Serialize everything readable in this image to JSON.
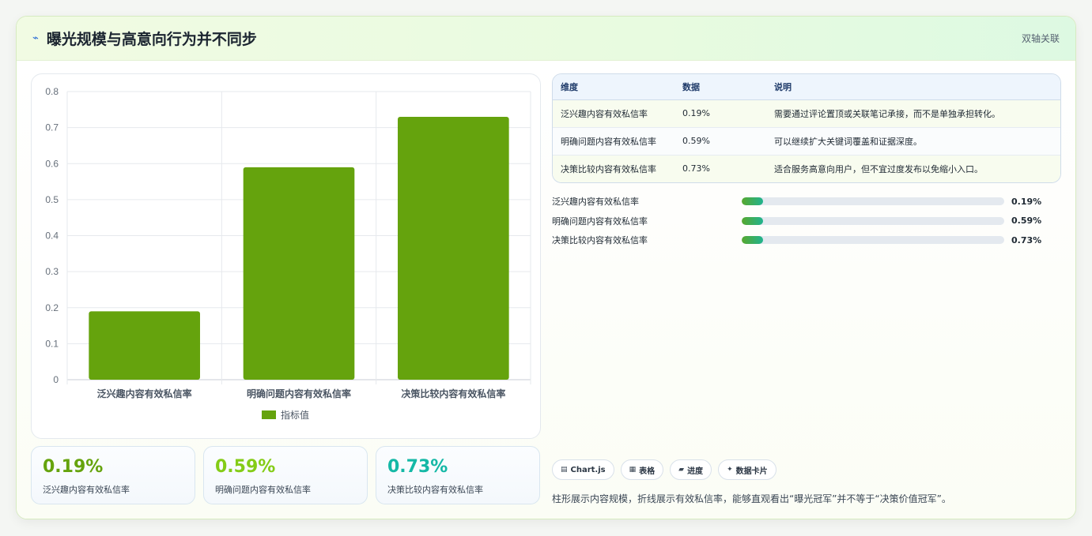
{
  "header": {
    "title": "曝光规模与高意向行为并不同步",
    "tag": "双轴关联"
  },
  "chart_data": {
    "type": "bar",
    "categories": [
      "泛兴趣内容有效私信率",
      "明确问题内容有效私信率",
      "决策比较内容有效私信率"
    ],
    "series": [
      {
        "name": "指标值",
        "values": [
          0.19,
          0.59,
          0.73
        ]
      }
    ],
    "yticks": [
      "0",
      "0.1",
      "0.2",
      "0.3",
      "0.4",
      "0.5",
      "0.6",
      "0.7",
      "0.8"
    ],
    "ylim": [
      0,
      0.8
    ],
    "grid": true,
    "legend": "bottom",
    "bar_color": "#65a30d"
  },
  "stats": [
    {
      "value": "0.19%",
      "label": "泛兴趣内容有效私信率",
      "color": "#65a30d"
    },
    {
      "value": "0.59%",
      "label": "明确问题内容有效私信率",
      "color": "#84cc16"
    },
    {
      "value": "0.73%",
      "label": "决策比较内容有效私信率",
      "color": "#14b8a6"
    }
  ],
  "table": {
    "headers": [
      "维度",
      "数据",
      "说明"
    ],
    "rows": [
      [
        "泛兴趣内容有效私信率",
        "0.19%",
        "需要通过评论置顶或关联笔记承接，而不是单独承担转化。"
      ],
      [
        "明确问题内容有效私信率",
        "0.59%",
        "可以继续扩大关键词覆盖和证据深度。"
      ],
      [
        "决策比较内容有效私信率",
        "0.73%",
        "适合服务高意向用户，但不宜过度发布以免缩小入口。"
      ]
    ]
  },
  "progress": [
    {
      "label": "泛兴趣内容有效私信率",
      "value": "0.19%",
      "fill": 0.08
    },
    {
      "label": "明确问题内容有效私信率",
      "value": "0.59%",
      "fill": 0.08
    },
    {
      "label": "决策比较内容有效私信率",
      "value": "0.73%",
      "fill": 0.08
    }
  ],
  "tags": [
    {
      "icon": "▤",
      "label": "Chart.js",
      "icon_name": "chart-icon"
    },
    {
      "icon": "▦",
      "label": "表格",
      "icon_name": "table-icon"
    },
    {
      "icon": "▰",
      "label": "进度",
      "icon_name": "progress-icon"
    },
    {
      "icon": "✦",
      "label": "数据卡片",
      "icon_name": "sparkle-icon"
    }
  ],
  "footnote": "柱形展示内容规模，折线展示有效私信率，能够直观看出“曝光冠军”并不等于“决策价值冠军”。"
}
